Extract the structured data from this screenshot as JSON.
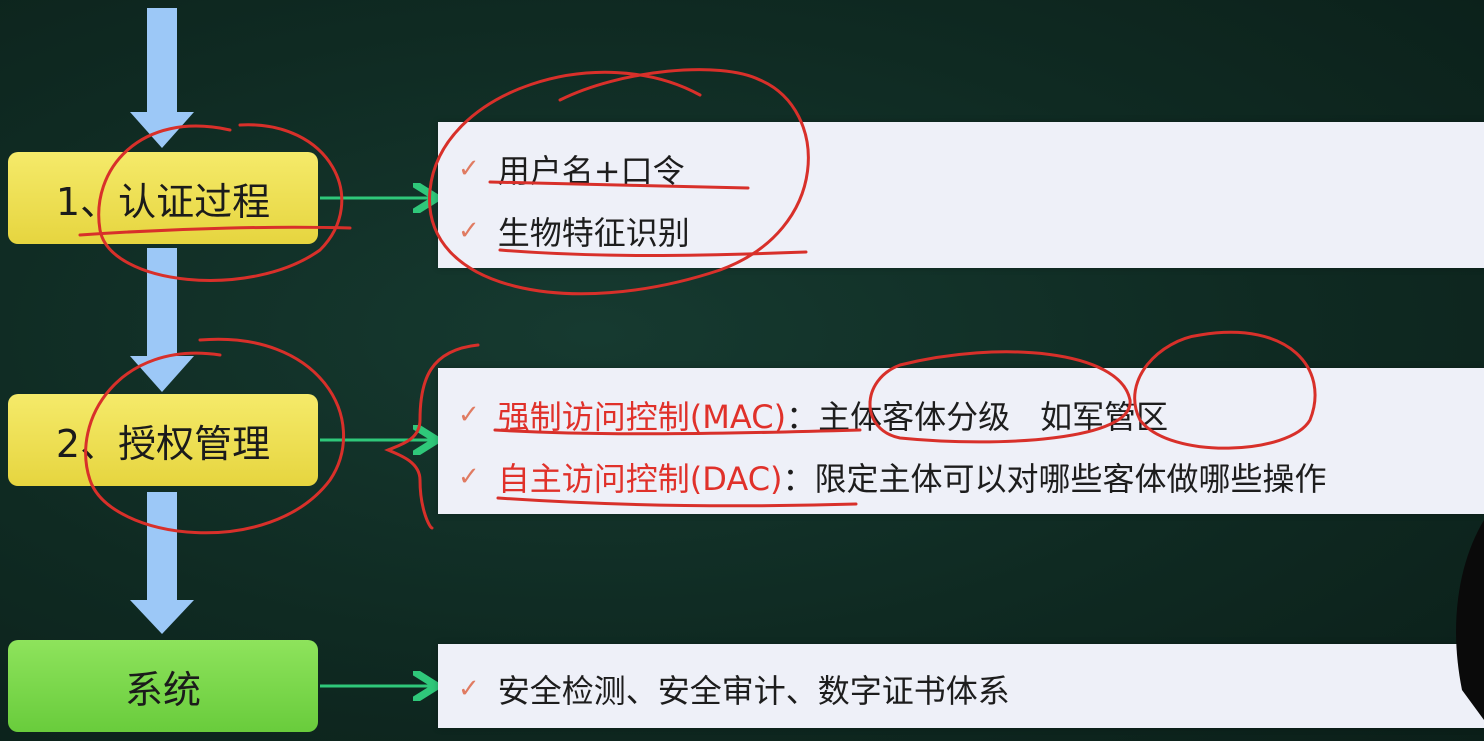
{
  "stages": [
    {
      "label": "1、认证过程"
    },
    {
      "label": "2、授权管理"
    },
    {
      "label": "系统"
    }
  ],
  "panels": {
    "auth": {
      "items": [
        "用户名+口令",
        "生物特征识别"
      ]
    },
    "authz": {
      "mac": {
        "term": "强制访问控制(MAC)",
        "separator": "：",
        "desc_a": "主体客体分级",
        "desc_b": "如军管区"
      },
      "dac": {
        "term": "自主访问控制(DAC)",
        "separator": "：",
        "desc": "限定主体可以对哪些客体做哪些操作"
      }
    },
    "system": {
      "items": [
        "安全检测、安全审计、数字证书体系"
      ]
    }
  },
  "colors": {
    "background": "#0f2a22",
    "stage_yellow": "#ecdc4d",
    "stage_green": "#7ad64a",
    "down_arrow": "#9cc8f7",
    "connector": "#2fc87a",
    "annotation_red": "#d8302a",
    "check_mark": "#e07b62"
  },
  "icons": {
    "bullet": "check-mark-icon"
  }
}
